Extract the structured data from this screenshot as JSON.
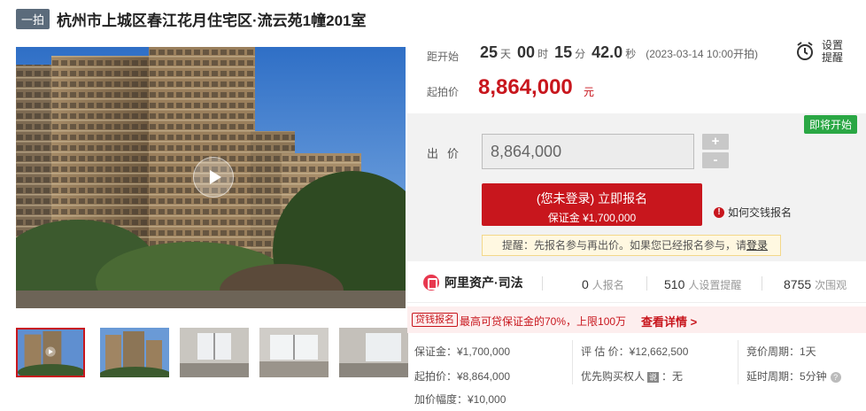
{
  "header": {
    "tag": "一拍",
    "title": "杭州市上城区春江花月住宅区·流云苑1幢201室"
  },
  "countdown": {
    "label": "距开始",
    "days": "25",
    "days_unit": "天",
    "hours": "00",
    "hours_unit": "时",
    "minutes": "15",
    "minutes_unit": "分",
    "seconds": "42.0",
    "seconds_unit": "秒",
    "start_note": "(2023-03-14 10:00开拍)"
  },
  "start_price": {
    "label": "起拍价",
    "value": "8,864,000",
    "unit": "元"
  },
  "reminder": {
    "label": "设置提醒"
  },
  "bidding": {
    "status_badge": "即将开始",
    "bid_label": "出价",
    "bid_value": "8,864,000",
    "plus": "+",
    "minus": "-",
    "signup_main": "(您未登录) 立即报名",
    "signup_sub": "保证金 ¥1,700,000",
    "howto": "如何交钱报名",
    "notice_prefix": "提醒：先报名参与再出价。如果您已经报名参与，请",
    "notice_link": "登录"
  },
  "organization": {
    "name": "阿里资产·司法",
    "stats": [
      {
        "value": "0",
        "label": "人报名"
      },
      {
        "value": "510",
        "label": "人设置提醒"
      },
      {
        "value": "8755",
        "label": "次围观"
      }
    ]
  },
  "loan": {
    "tag": "贷钱报名",
    "text": "最高可贷保证金的70%，上限100万",
    "link": "查看详情 >"
  },
  "details": {
    "deposit": "保证金：¥1,700,000",
    "start_price": "起拍价：¥8,864,000",
    "increment": "加价幅度：¥10,000",
    "appraisal": "评 估 价：¥12,662,500",
    "priority_label": "优先购买权人",
    "priority_badge": "说",
    "priority_value": "：无",
    "cycle": "竞价周期：1天",
    "delay": "延时周期：5分钟"
  },
  "icons": {
    "play": "play-icon",
    "alarm": "alarm-clock-icon",
    "warning": "warning-icon",
    "org_logo": "auction-logo-icon",
    "help": "question-icon"
  },
  "colors": {
    "brand_red": "#c8161d",
    "green_badge": "#2aa744",
    "tag_gray": "#5b6b7b"
  }
}
